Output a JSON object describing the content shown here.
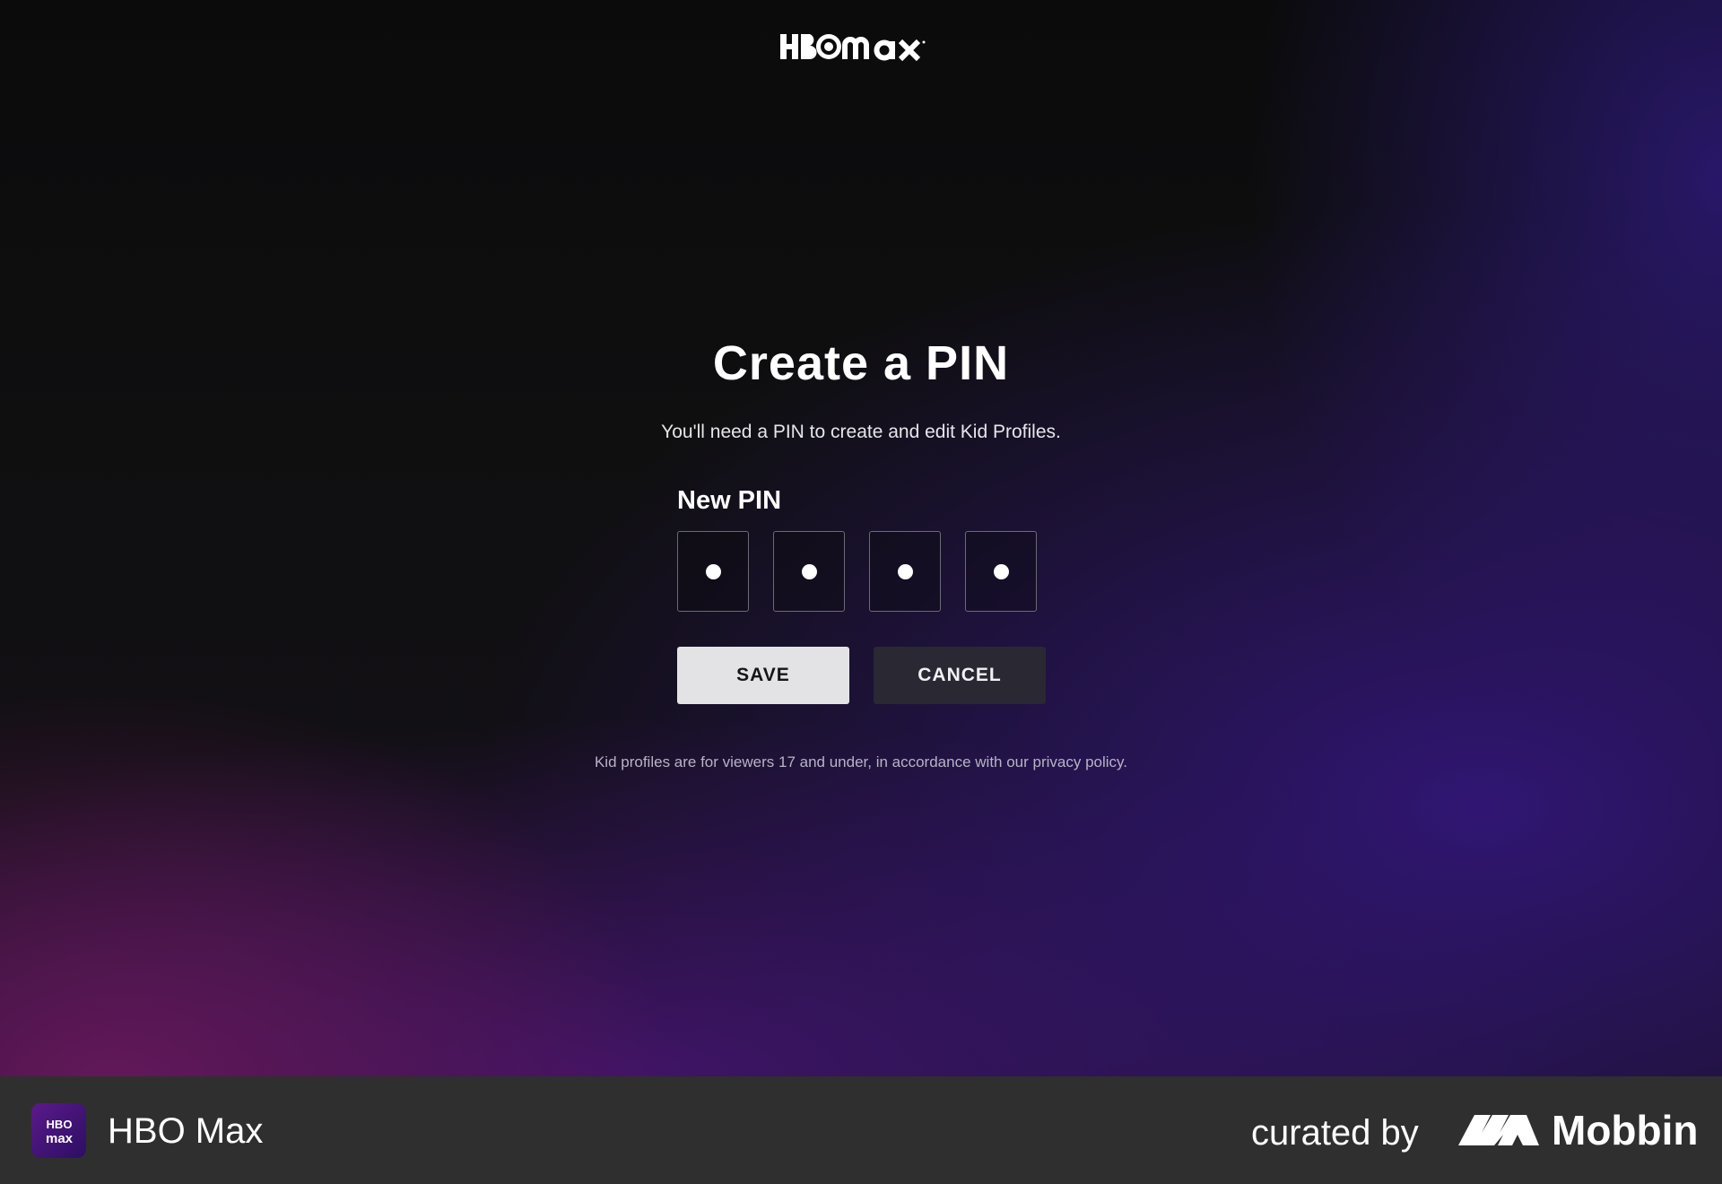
{
  "header": {
    "logo_text": "HBO max"
  },
  "main": {
    "title": "Create a PIN",
    "subtitle": "You'll need a PIN to create and edit Kid Profiles.",
    "pin_label": "New PIN",
    "pin_digits": [
      "•",
      "•",
      "•",
      "•"
    ],
    "save_label": "SAVE",
    "cancel_label": "CANCEL",
    "note": "Kid profiles are for viewers 17 and under, in accordance with our privacy policy."
  },
  "footer": {
    "app_icon_text": "HBO max",
    "app_name": "HBO Max",
    "curated_by": "curated by",
    "brand": "Mobbin"
  },
  "colors": {
    "save_bg": "#e3e3e6",
    "cancel_bg": "#2a2833",
    "footer_bg": "#2f2f2f",
    "accent_purple": "#2c1e6e"
  }
}
